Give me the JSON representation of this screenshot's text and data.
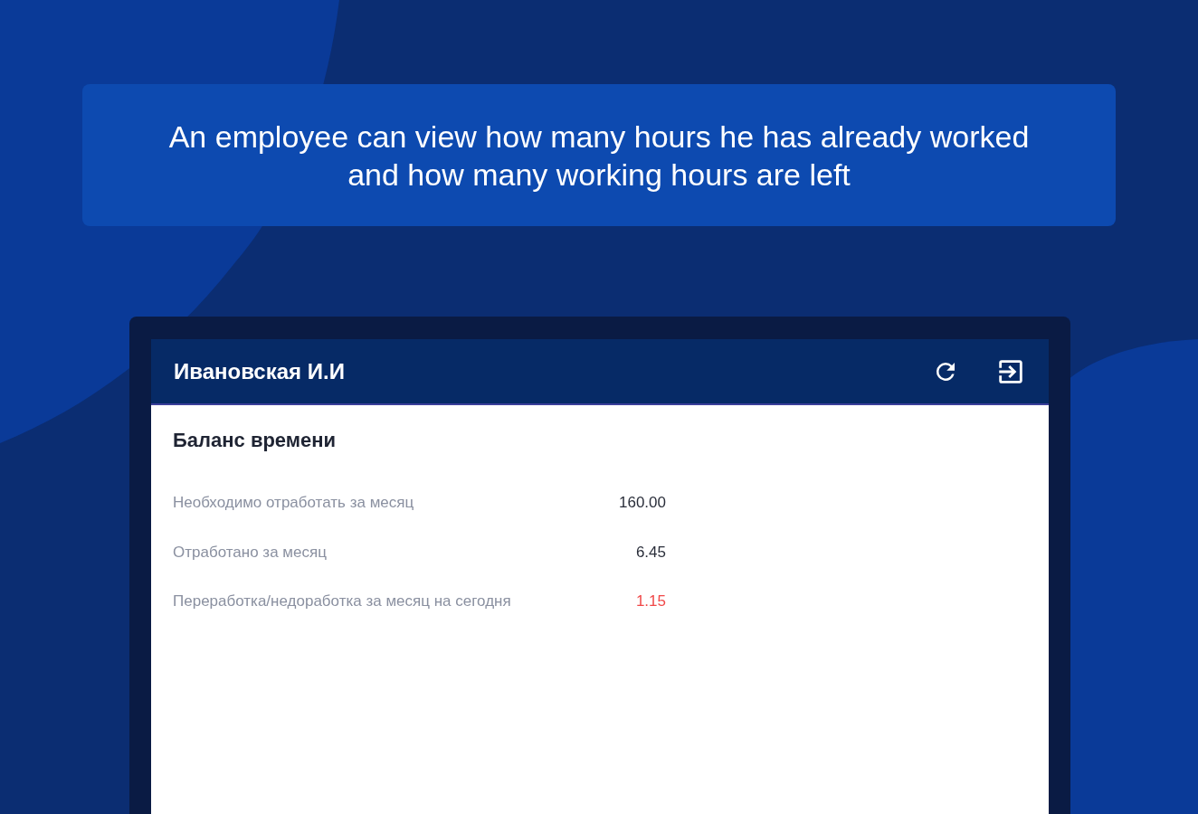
{
  "caption": "An employee can view how many hours he has already worked and how many working hours are left",
  "app": {
    "user_name": "Ивановская И.И",
    "section_title": "Баланс времени",
    "rows": [
      {
        "label": "Необходимо отработать за месяц",
        "value": "160.00",
        "highlight": false
      },
      {
        "label": "Отработано за месяц",
        "value": "6.45",
        "highlight": false
      },
      {
        "label": "Переработка/недоработка за месяц на сегодня",
        "value": "1.15",
        "highlight": true
      }
    ]
  }
}
